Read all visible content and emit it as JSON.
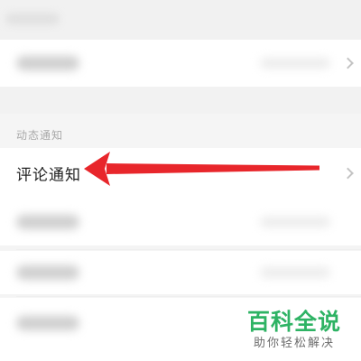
{
  "section": {
    "title": "动态通知"
  },
  "rows": {
    "comment_label": "评论通知"
  },
  "watermark": {
    "title": "百科全说",
    "subtitle": "助你轻松解决"
  },
  "colors": {
    "arrow": "#e8262b",
    "watermark_green": "#2eb364",
    "section_text": "#a9a9a9"
  },
  "icons": {
    "row_chevron": "chevron-right-icon",
    "annotation": "red-arrow-icon"
  }
}
